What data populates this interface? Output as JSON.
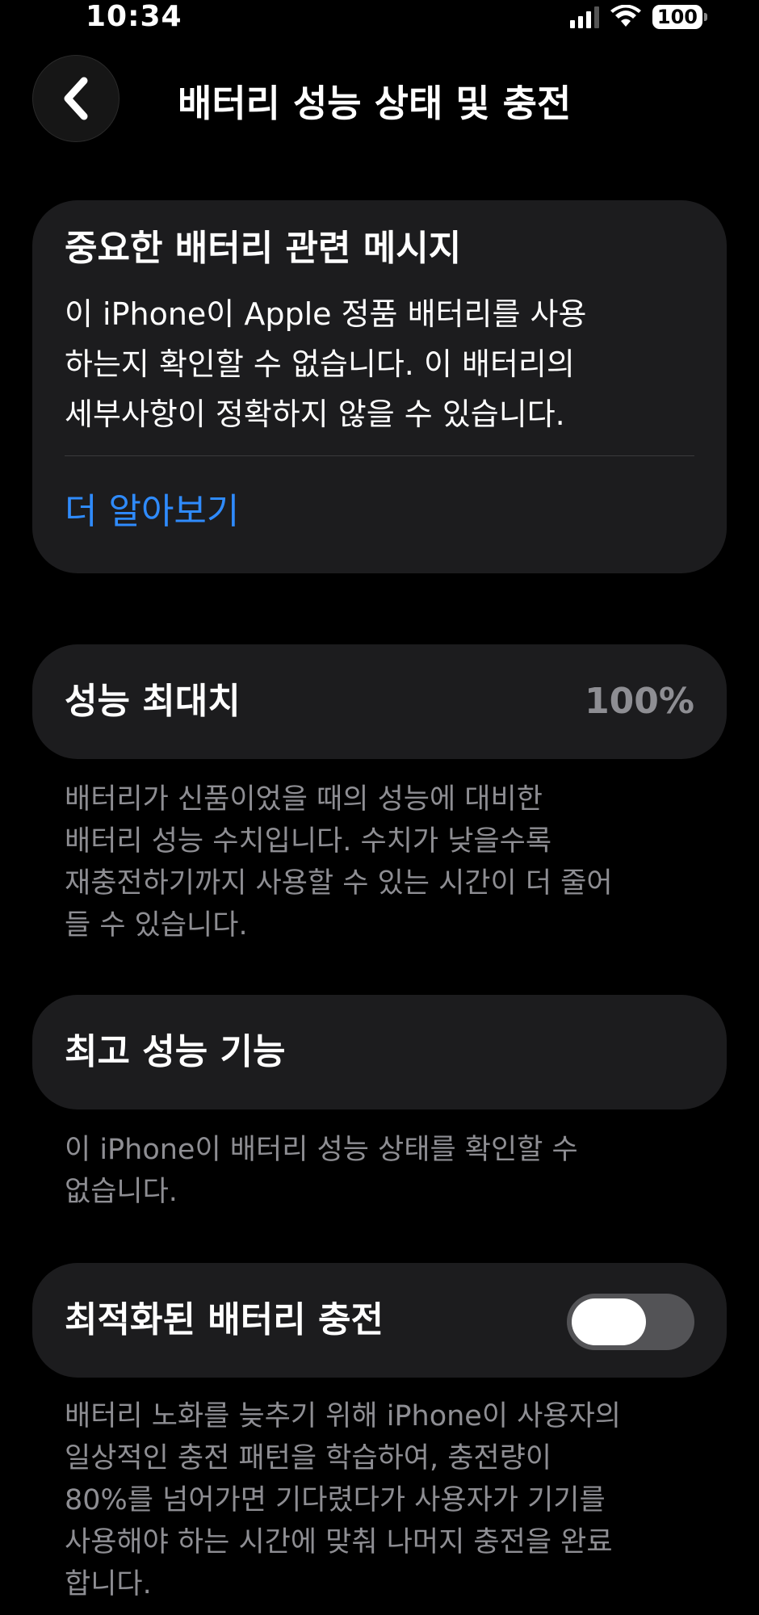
{
  "status_bar": {
    "time": "10:34",
    "battery_level": "100",
    "signal_bars": 4,
    "signal_bars_active": 3,
    "icons": [
      "cellular-signal-icon",
      "wifi-icon",
      "battery-icon"
    ]
  },
  "header": {
    "title": "배터리 성능 상태 및 충전",
    "back_icon": "chevron-left-icon"
  },
  "message_card": {
    "title": "중요한 배터리 관련 메시지",
    "body_lines": [
      "이 iPhone이 Apple 정품 배터리를 사용",
      "하는지 확인할 수 없습니다. 이 배터리의",
      "세부사항이 정확하지 않을 수 있습니다."
    ],
    "link": "더 알아보기",
    "link_color": "#2f8bfd"
  },
  "max_capacity": {
    "label": "성능 최대치",
    "value": "100%",
    "footnote_lines": [
      "배터리가 신품이었을 때의 성능에 대비한",
      "배터리 성능 수치입니다. 수치가 낮을수록",
      "재충전하기까지 사용할 수 있는 시간이 더 줄어",
      "들 수 있습니다."
    ]
  },
  "peak_performance": {
    "label": "최고 성능 기능",
    "footnote_lines": [
      "이 iPhone이 배터리 성능 상태를 확인할 수",
      "없습니다."
    ]
  },
  "optimized_charging": {
    "label": "최적화된 배터리 충전",
    "toggle_on": false,
    "footnote_lines": [
      "배터리 노화를 늦추기 위해 iPhone이 사용자의",
      "일상적인 충전 패턴을 학습하여, 충전량이",
      "80%를 넘어가면 기다렸다가 사용자가 기기를",
      "사용해야 하는 시간에 맞춰 나머지 충전을 완료",
      "합니다."
    ]
  },
  "colors": {
    "background": "#000000",
    "card": "#1c1c1e",
    "secondary_text": "#8e8e93",
    "toggle_off_track": "#535356"
  }
}
